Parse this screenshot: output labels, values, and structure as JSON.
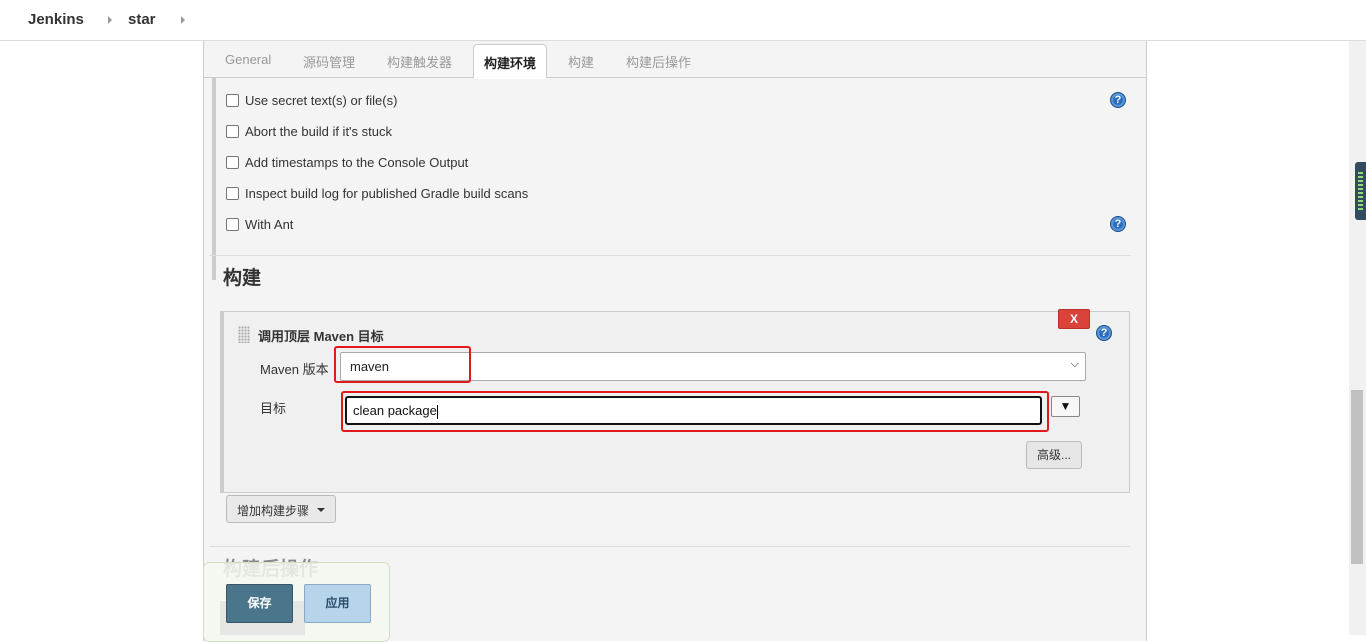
{
  "breadcrumb": {
    "root": "Jenkins",
    "job": "star"
  },
  "tabs": [
    {
      "label": "General",
      "active": false
    },
    {
      "label": "源码管理",
      "active": false
    },
    {
      "label": "构建触发器",
      "active": false
    },
    {
      "label": "构建环境",
      "active": true
    },
    {
      "label": "构建",
      "active": false
    },
    {
      "label": "构建后操作",
      "active": false
    }
  ],
  "build_env": {
    "options": [
      {
        "label": "Use secret text(s) or file(s)",
        "checked": false
      },
      {
        "label": "Abort the build if it's stuck",
        "checked": false
      },
      {
        "label": "Add timestamps to the Console Output",
        "checked": false
      },
      {
        "label": "Inspect build log for published Gradle build scans",
        "checked": false
      },
      {
        "label": "With Ant",
        "checked": false
      }
    ],
    "help_glyph": "?"
  },
  "build": {
    "section_title": "构建",
    "step": {
      "title": "调用顶层 Maven 目标",
      "delete_label": "X",
      "maven_version_label": "Maven 版本",
      "maven_version_value": "maven",
      "goals_label": "目标",
      "goals_value": "clean package",
      "goals_expand_label": "▼",
      "advanced_label": "高级..."
    },
    "add_step_label": "增加构建步骤"
  },
  "post_build": {
    "section_title": "构建后操作"
  },
  "actions": {
    "save_label": "保存",
    "apply_label": "应用"
  },
  "colors": {
    "save": "#4b758b",
    "apply": "#b6d4ea",
    "delete": "#d9433a",
    "highlight": "#e0191c",
    "help": "#2a6ebd"
  },
  "icons": [
    "breadcrumb-chevron-icon",
    "help-icon",
    "drag-handle-icon",
    "dropdown-caret-icon"
  ]
}
